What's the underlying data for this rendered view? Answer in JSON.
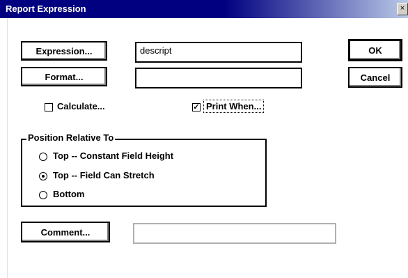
{
  "window": {
    "title": "Report Expression",
    "close_glyph": "×"
  },
  "buttons": {
    "expression": "Expression...",
    "format": "Format...",
    "ok": "OK",
    "cancel": "Cancel",
    "comment": "Comment..."
  },
  "fields": {
    "expression_value": "descript",
    "format_value": "",
    "comment_value": ""
  },
  "checkboxes": {
    "calculate": {
      "label": "Calculate...",
      "checked": false
    },
    "print_when": {
      "label": "Print When...",
      "checked": true,
      "mark": "✓"
    }
  },
  "position_group": {
    "title": "Position Relative To",
    "options": [
      {
        "label": "Top -- Constant Field Height",
        "selected": false
      },
      {
        "label": "Top -- Field Can Stretch",
        "selected": true
      },
      {
        "label": "Bottom",
        "selected": false
      }
    ]
  }
}
